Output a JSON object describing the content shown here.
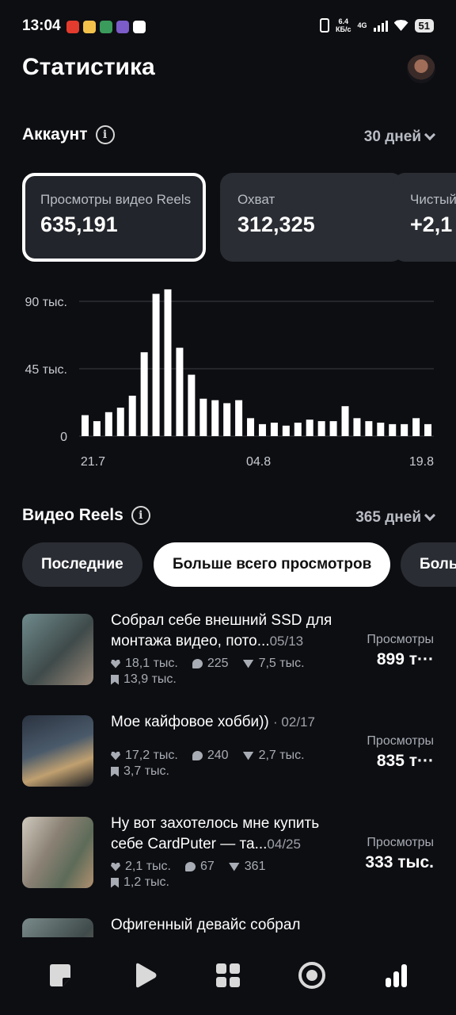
{
  "status_bar": {
    "time": "13:04",
    "net_speed": "6.4\nКБ/с",
    "network": "4G",
    "battery": "51"
  },
  "header": {
    "title": "Статистика"
  },
  "account": {
    "title": "Аккаунт",
    "period": "30 дней",
    "cards": [
      {
        "label": "Просмотры видео Reels",
        "value": "635,191"
      },
      {
        "label": "Охват",
        "value": "312,325"
      },
      {
        "label": "Чистый",
        "value": "+2,1"
      }
    ]
  },
  "chart_data": {
    "type": "bar",
    "ytick_labels": [
      "90 тыс.",
      "45 тыс.",
      "0"
    ],
    "xtick_labels": [
      "21.7",
      "04.8",
      "19.8"
    ],
    "ylim": [
      0,
      90000
    ],
    "grid": true,
    "values": [
      14000,
      10000,
      16000,
      19000,
      27000,
      56000,
      95000,
      98000,
      59000,
      41000,
      25000,
      24000,
      22000,
      24000,
      12000,
      8000,
      9000,
      7000,
      9000,
      11000,
      10000,
      10000,
      20000,
      12000,
      10000,
      9000,
      8000,
      8000,
      12000,
      8000
    ]
  },
  "reels": {
    "title": "Видео Reels",
    "period": "365 дней",
    "tabs": [
      "Последние",
      "Больше всего просмотров",
      "Боль"
    ],
    "views_label": "Просмотры",
    "items": [
      {
        "title": "Собрал себе внешний SSD для монтажа видео, пото...",
        "date": "05/13",
        "likes": "18,1 тыс.",
        "comments": "225",
        "shares": "7,5 тыс.",
        "saves": "13,9 тыс.",
        "views": "899 т···"
      },
      {
        "title": "Мое кайфовое хобби))",
        "date": "· 02/17",
        "likes": "17,2 тыс.",
        "comments": "240",
        "shares": "2,7 тыс.",
        "saves": "3,7 тыс.",
        "views": "835 т···"
      },
      {
        "title": "Ну вот захотелось мне купить себе CardPuter — та...",
        "date": "04/25",
        "likes": "2,1 тыс.",
        "comments": "67",
        "shares": "361",
        "saves": "1,2 тыс.",
        "views": "333 тыс."
      },
      {
        "title": "Офигенный девайс собрал",
        "date": "",
        "likes": "",
        "comments": "",
        "shares": "",
        "saves": "",
        "views": ""
      }
    ]
  },
  "nav": {
    "icons": [
      "home-icon",
      "reels-icon",
      "grid-icon",
      "circle-icon",
      "stats-icon"
    ]
  }
}
